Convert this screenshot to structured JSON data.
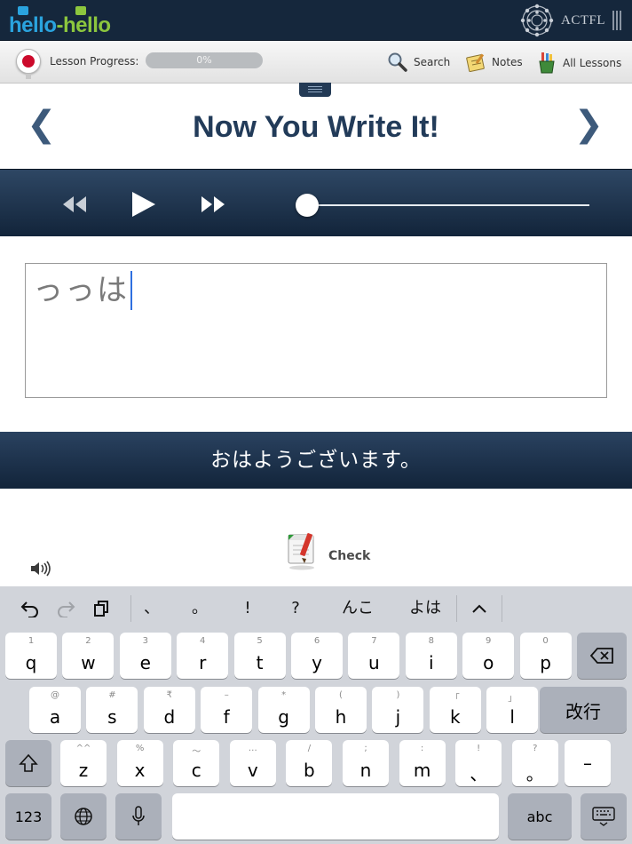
{
  "brand": {
    "logo_left": "hello",
    "logo_dash": "-",
    "logo_right": "hello",
    "partner": "ACTFL"
  },
  "toolbar": {
    "progress_label": "Lesson Progress:",
    "progress_value": 0,
    "progress_text": "0%",
    "search_label": "Search",
    "notes_label": "Notes",
    "all_lessons_label": "All Lessons"
  },
  "lesson": {
    "title": "Now You Write It!",
    "prev_glyph": "❮",
    "next_glyph": "❯"
  },
  "player": {
    "position": 0
  },
  "answer": {
    "value": "っっは"
  },
  "prompt": {
    "text": "おはようございます。"
  },
  "actions": {
    "check_label": "Check"
  },
  "keyboard": {
    "suggestions": [
      "、",
      "。",
      "!",
      "?",
      "んこ",
      "よは"
    ],
    "collapse_glyph": "^",
    "row1": [
      {
        "hint": "1",
        "key": "q"
      },
      {
        "hint": "2",
        "key": "w"
      },
      {
        "hint": "3",
        "key": "e"
      },
      {
        "hint": "4",
        "key": "r"
      },
      {
        "hint": "5",
        "key": "t"
      },
      {
        "hint": "6",
        "key": "y"
      },
      {
        "hint": "7",
        "key": "u"
      },
      {
        "hint": "8",
        "key": "i"
      },
      {
        "hint": "9",
        "key": "o"
      },
      {
        "hint": "0",
        "key": "p"
      }
    ],
    "row2": [
      {
        "hint": "@",
        "key": "a"
      },
      {
        "hint": "#",
        "key": "s"
      },
      {
        "hint": "₹",
        "key": "d"
      },
      {
        "hint": "–",
        "key": "f"
      },
      {
        "hint": "*",
        "key": "g"
      },
      {
        "hint": "(",
        "key": "h"
      },
      {
        "hint": ")",
        "key": "j"
      },
      {
        "hint": "「",
        "key": "k"
      },
      {
        "hint": "」",
        "key": "l"
      }
    ],
    "return_label": "改行",
    "row3": [
      {
        "hint": "^^",
        "key": "z"
      },
      {
        "hint": "%",
        "key": "x"
      },
      {
        "hint": "〜",
        "key": "c"
      },
      {
        "hint": "…",
        "key": "v"
      },
      {
        "hint": "/",
        "key": "b"
      },
      {
        "hint": ";",
        "key": "n"
      },
      {
        "hint": ":",
        "key": "m"
      },
      {
        "hint": "!",
        "key": "、"
      },
      {
        "hint": "?",
        "key": "。"
      }
    ],
    "dash_key": "–",
    "numbers_label": "123",
    "abc_label": "abc"
  }
}
